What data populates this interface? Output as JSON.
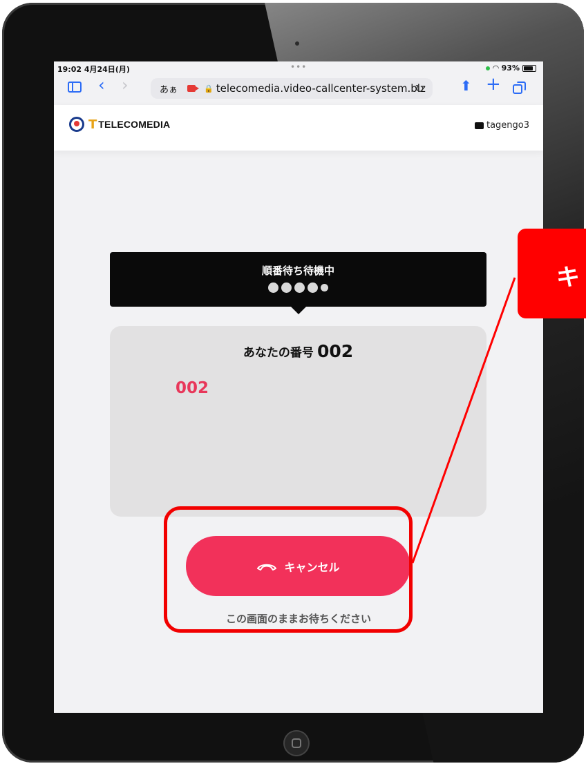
{
  "status_bar": {
    "time": "19:02  4月24日(月)",
    "battery": "93%",
    "battery_level": 0.93,
    "dots": "•••"
  },
  "browser": {
    "text_size_button": "あぁ",
    "url": "telecomedia.video-callcenter-system.biz"
  },
  "header": {
    "logo_text": "TELECOMEDIA",
    "username": "tagengo3"
  },
  "queue": {
    "title": "順番待ち待機中"
  },
  "ticket": {
    "label": "あなたの番号",
    "number": "002",
    "current_number": "002"
  },
  "actions": {
    "cancel_label": "キャンセル",
    "wait_note": "この画面のままお待ちください"
  },
  "callout": {
    "text": "キ"
  },
  "colors": {
    "accent": "#f2315a",
    "callout_red": "#ff0000",
    "link_blue": "#2c6cf6",
    "number_red": "#e8375a"
  }
}
